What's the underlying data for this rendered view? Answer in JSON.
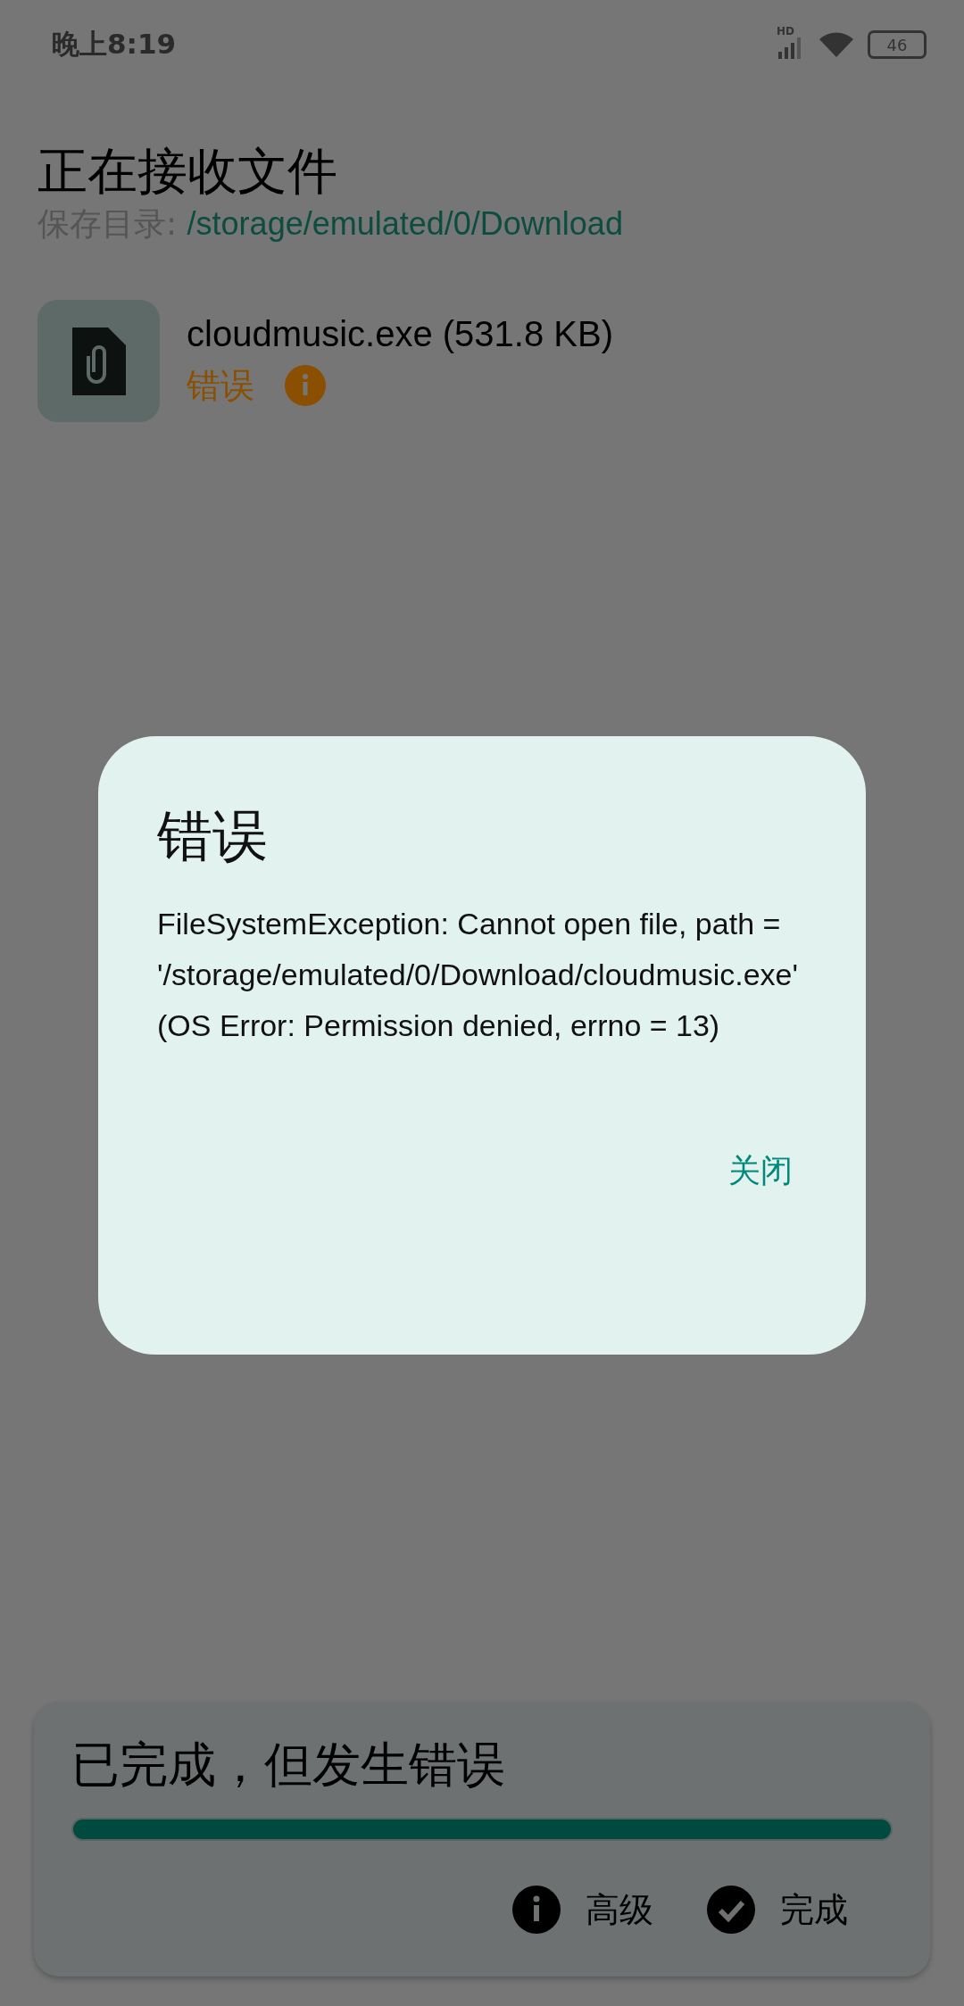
{
  "status_bar": {
    "time": "晚上8:19",
    "network_label": "HD",
    "battery": "46"
  },
  "header": {
    "title": "正在接收文件",
    "save_dir_label": "保存目录:",
    "save_dir_path": "/storage/emulated/0/Download"
  },
  "files": [
    {
      "name": "cloudmusic.exe (531.8 KB)",
      "status": "错误",
      "kind": "error"
    }
  ],
  "dialog": {
    "title": "错误",
    "message": "FileSystemException: Cannot open file, path = '/storage/emulated/0/Download/cloudmusic.exe' (OS Error: Permission denied, errno = 13)",
    "buttons": [
      "关闭"
    ]
  },
  "progress_card": {
    "title": "已完成，但发生错误",
    "level": 1,
    "actions": [
      {
        "label": "高级",
        "kind": "info"
      },
      {
        "label": "完成",
        "kind": "done"
      }
    ]
  }
}
